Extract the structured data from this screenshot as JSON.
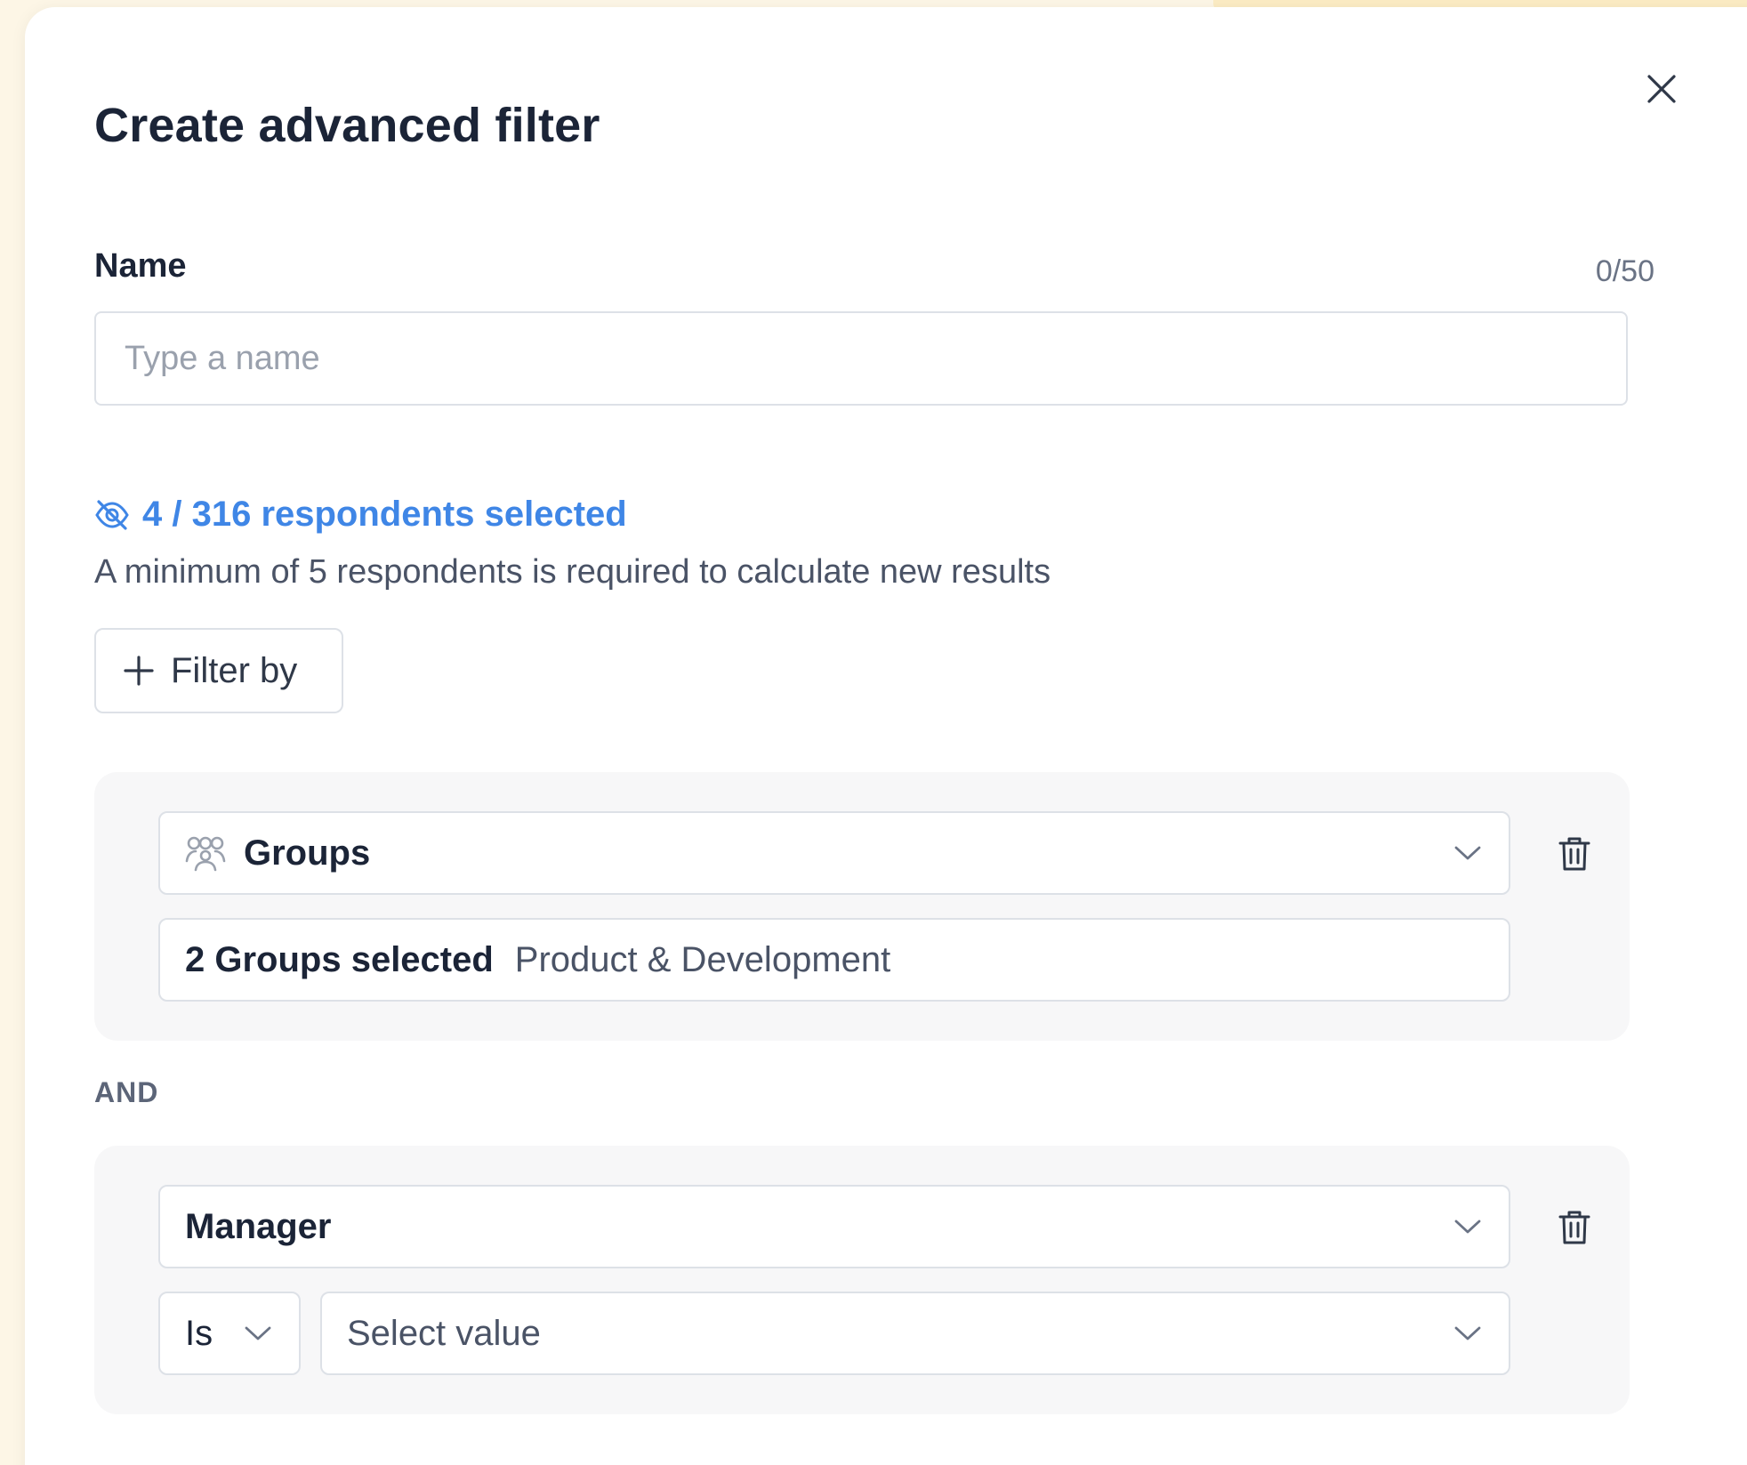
{
  "modal": {
    "title": "Create advanced filter",
    "close_icon": "close-icon"
  },
  "name_field": {
    "label": "Name",
    "char_count": "0/50",
    "value": "",
    "placeholder": "Type a name"
  },
  "respondents": {
    "icon": "eye-off-icon",
    "selected_text": "4 / 316 respondents selected",
    "hint": "A minimum of 5 respondents is required to calculate new results"
  },
  "filter_by_button": {
    "icon": "plus-icon",
    "label": "Filter by"
  },
  "filters": [
    {
      "field_icon": "groups-icon",
      "field_label": "Groups",
      "values_count": "2 Groups selected",
      "values_names": "Product & Development"
    },
    {
      "field_label": "Manager",
      "operator": "Is",
      "value_placeholder": "Select value"
    }
  ],
  "connector": "AND",
  "colors": {
    "accent_blue": "#3f86e6",
    "text_dark": "#1b2437",
    "card_bg": "#f7f7f8",
    "backdrop": "#fdf6e6"
  }
}
